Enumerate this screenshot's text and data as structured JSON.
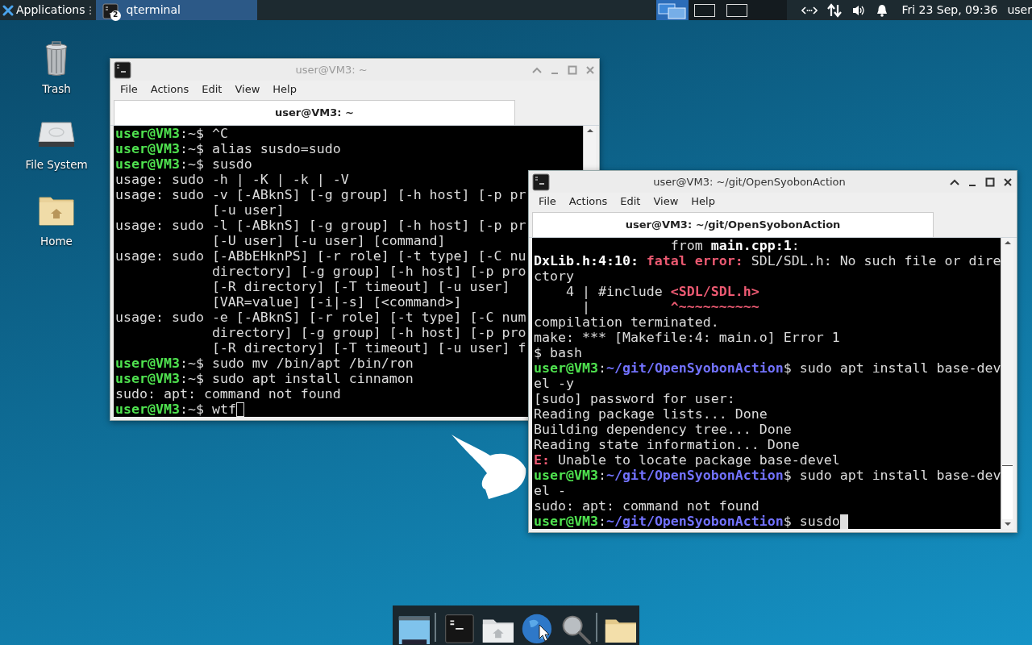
{
  "top_panel": {
    "applications": "Applications",
    "taskbar": [
      {
        "label": "qterminal",
        "count": "2",
        "selected": true
      }
    ],
    "workspaces": [
      {
        "selected": true
      },
      {
        "selected": false
      },
      {
        "selected": false
      }
    ],
    "clock": "Fri 23 Sep, 09:36",
    "user": "user"
  },
  "desktop_icons": [
    {
      "kind": "trash",
      "label": "Trash"
    },
    {
      "kind": "drive",
      "label": "File System"
    },
    {
      "kind": "home",
      "label": "Home"
    }
  ],
  "windows": [
    {
      "title": "user@VM3: ~",
      "focused": false,
      "menu": [
        "File",
        "Actions",
        "Edit",
        "View",
        "Help"
      ],
      "tab": "user@VM3: ~",
      "lines": [
        [
          {
            "kind": "user",
            "text": "user@VM3"
          },
          {
            "kind": "plain",
            "text": ":~$ ^C"
          }
        ],
        [
          {
            "kind": "user",
            "text": "user@VM3"
          },
          {
            "kind": "plain",
            "text": ":~$ alias susdo=sudo"
          }
        ],
        [
          {
            "kind": "user",
            "text": "user@VM3"
          },
          {
            "kind": "plain",
            "text": ":~$ susdo"
          }
        ],
        [
          {
            "kind": "plain",
            "text": "usage: sudo -h | -K | -k | -V"
          }
        ],
        [
          {
            "kind": "plain",
            "text": "usage: sudo -v [-ABknS] [-g group] [-h host] [-p pr"
          }
        ],
        [
          {
            "kind": "plain",
            "text": "            [-u user]"
          }
        ],
        [
          {
            "kind": "plain",
            "text": "usage: sudo -l [-ABknS] [-g group] [-h host] [-p pr"
          }
        ],
        [
          {
            "kind": "plain",
            "text": "            [-U user] [-u user] [command]"
          }
        ],
        [
          {
            "kind": "plain",
            "text": "usage: sudo [-ABbEHknPS] [-r role] [-t type] [-C nu"
          }
        ],
        [
          {
            "kind": "plain",
            "text": "            directory] [-g group] [-h host] [-p pro"
          }
        ],
        [
          {
            "kind": "plain",
            "text": "            [-R directory] [-T timeout] [-u user]"
          }
        ],
        [
          {
            "kind": "plain",
            "text": "            [VAR=value] [-i|-s] [<command>]"
          }
        ],
        [
          {
            "kind": "plain",
            "text": "usage: sudo -e [-ABknS] [-r role] [-t type] [-C num"
          }
        ],
        [
          {
            "kind": "plain",
            "text": "            directory] [-g group] [-h host] [-p pro"
          }
        ],
        [
          {
            "kind": "plain",
            "text": "            [-R directory] [-T timeout] [-u user] f"
          }
        ],
        [
          {
            "kind": "user",
            "text": "user@VM3"
          },
          {
            "kind": "plain",
            "text": ":~$ sudo mv /bin/apt /bin/ron"
          }
        ],
        [
          {
            "kind": "user",
            "text": "user@VM3"
          },
          {
            "kind": "plain",
            "text": ":~$ sudo apt install cinnamon"
          }
        ],
        [
          {
            "kind": "plain",
            "text": "sudo: apt: command not found"
          }
        ],
        [
          {
            "kind": "user",
            "text": "user@VM3"
          },
          {
            "kind": "plain",
            "text": ":~$ wtf"
          }
        ]
      ]
    },
    {
      "title": "user@VM3: ~/git/OpenSyobonAction",
      "focused": true,
      "menu": [
        "File",
        "Actions",
        "Edit",
        "View",
        "Help"
      ],
      "tab": "user@VM3: ~/git/OpenSyobonAction",
      "lines": [
        [
          {
            "kind": "plain",
            "text": "                 from "
          },
          {
            "kind": "bold",
            "text": "main.cpp:1"
          },
          {
            "kind": "plain",
            "text": ":"
          }
        ],
        [
          {
            "kind": "bold",
            "text": "DxLib.h:4:10:"
          },
          {
            "kind": "error",
            "text": " fatal error:"
          },
          {
            "kind": "plain",
            "text": " SDL/SDL.h: No such file or dire"
          }
        ],
        [
          {
            "kind": "plain",
            "text": "ctory"
          }
        ],
        [
          {
            "kind": "plain",
            "text": "    4 | #include "
          },
          {
            "kind": "error",
            "text": "<SDL/SDL.h>"
          }
        ],
        [
          {
            "kind": "plain",
            "text": "      |          "
          },
          {
            "kind": "error",
            "text": "^~~~~~~~~~~"
          }
        ],
        [
          {
            "kind": "plain",
            "text": "compilation terminated."
          }
        ],
        [
          {
            "kind": "plain",
            "text": "make: *** [Makefile:4: main.o] Error 1"
          }
        ],
        [
          {
            "kind": "plain",
            "text": "$ bash"
          }
        ],
        [
          {
            "kind": "user",
            "text": "user@VM3"
          },
          {
            "kind": "plain",
            "text": ":"
          },
          {
            "kind": "path",
            "text": "~/git/OpenSyobonAction"
          },
          {
            "kind": "plain",
            "text": "$ sudo apt install base-dev"
          }
        ],
        [
          {
            "kind": "plain",
            "text": "el -y"
          }
        ],
        [
          {
            "kind": "plain",
            "text": "[sudo] password for user:"
          }
        ],
        [
          {
            "kind": "plain",
            "text": "Reading package lists... Done"
          }
        ],
        [
          {
            "kind": "plain",
            "text": "Building dependency tree... Done"
          }
        ],
        [
          {
            "kind": "plain",
            "text": "Reading state information... Done"
          }
        ],
        [
          {
            "kind": "error",
            "text": "E:"
          },
          {
            "kind": "plain",
            "text": " Unable to locate package base-devel"
          }
        ],
        [
          {
            "kind": "user",
            "text": "user@VM3"
          },
          {
            "kind": "plain",
            "text": ":"
          },
          {
            "kind": "path",
            "text": "~/git/OpenSyobonAction"
          },
          {
            "kind": "plain",
            "text": "$ sudo apt install base-dev"
          }
        ],
        [
          {
            "kind": "plain",
            "text": "el -"
          }
        ],
        [
          {
            "kind": "plain",
            "text": "sudo: apt: command not found"
          }
        ],
        [
          {
            "kind": "user",
            "text": "user@VM3"
          },
          {
            "kind": "plain",
            "text": ":"
          },
          {
            "kind": "path",
            "text": "~/git/OpenSyobonAction"
          },
          {
            "kind": "plain",
            "text": "$ susdo"
          }
        ]
      ]
    }
  ],
  "dock": [
    {
      "kind": "show-desktop"
    },
    {
      "kind": "separator"
    },
    {
      "kind": "terminal"
    },
    {
      "kind": "home-folder"
    },
    {
      "kind": "browser"
    },
    {
      "kind": "search"
    },
    {
      "kind": "separator"
    },
    {
      "kind": "folder"
    }
  ]
}
